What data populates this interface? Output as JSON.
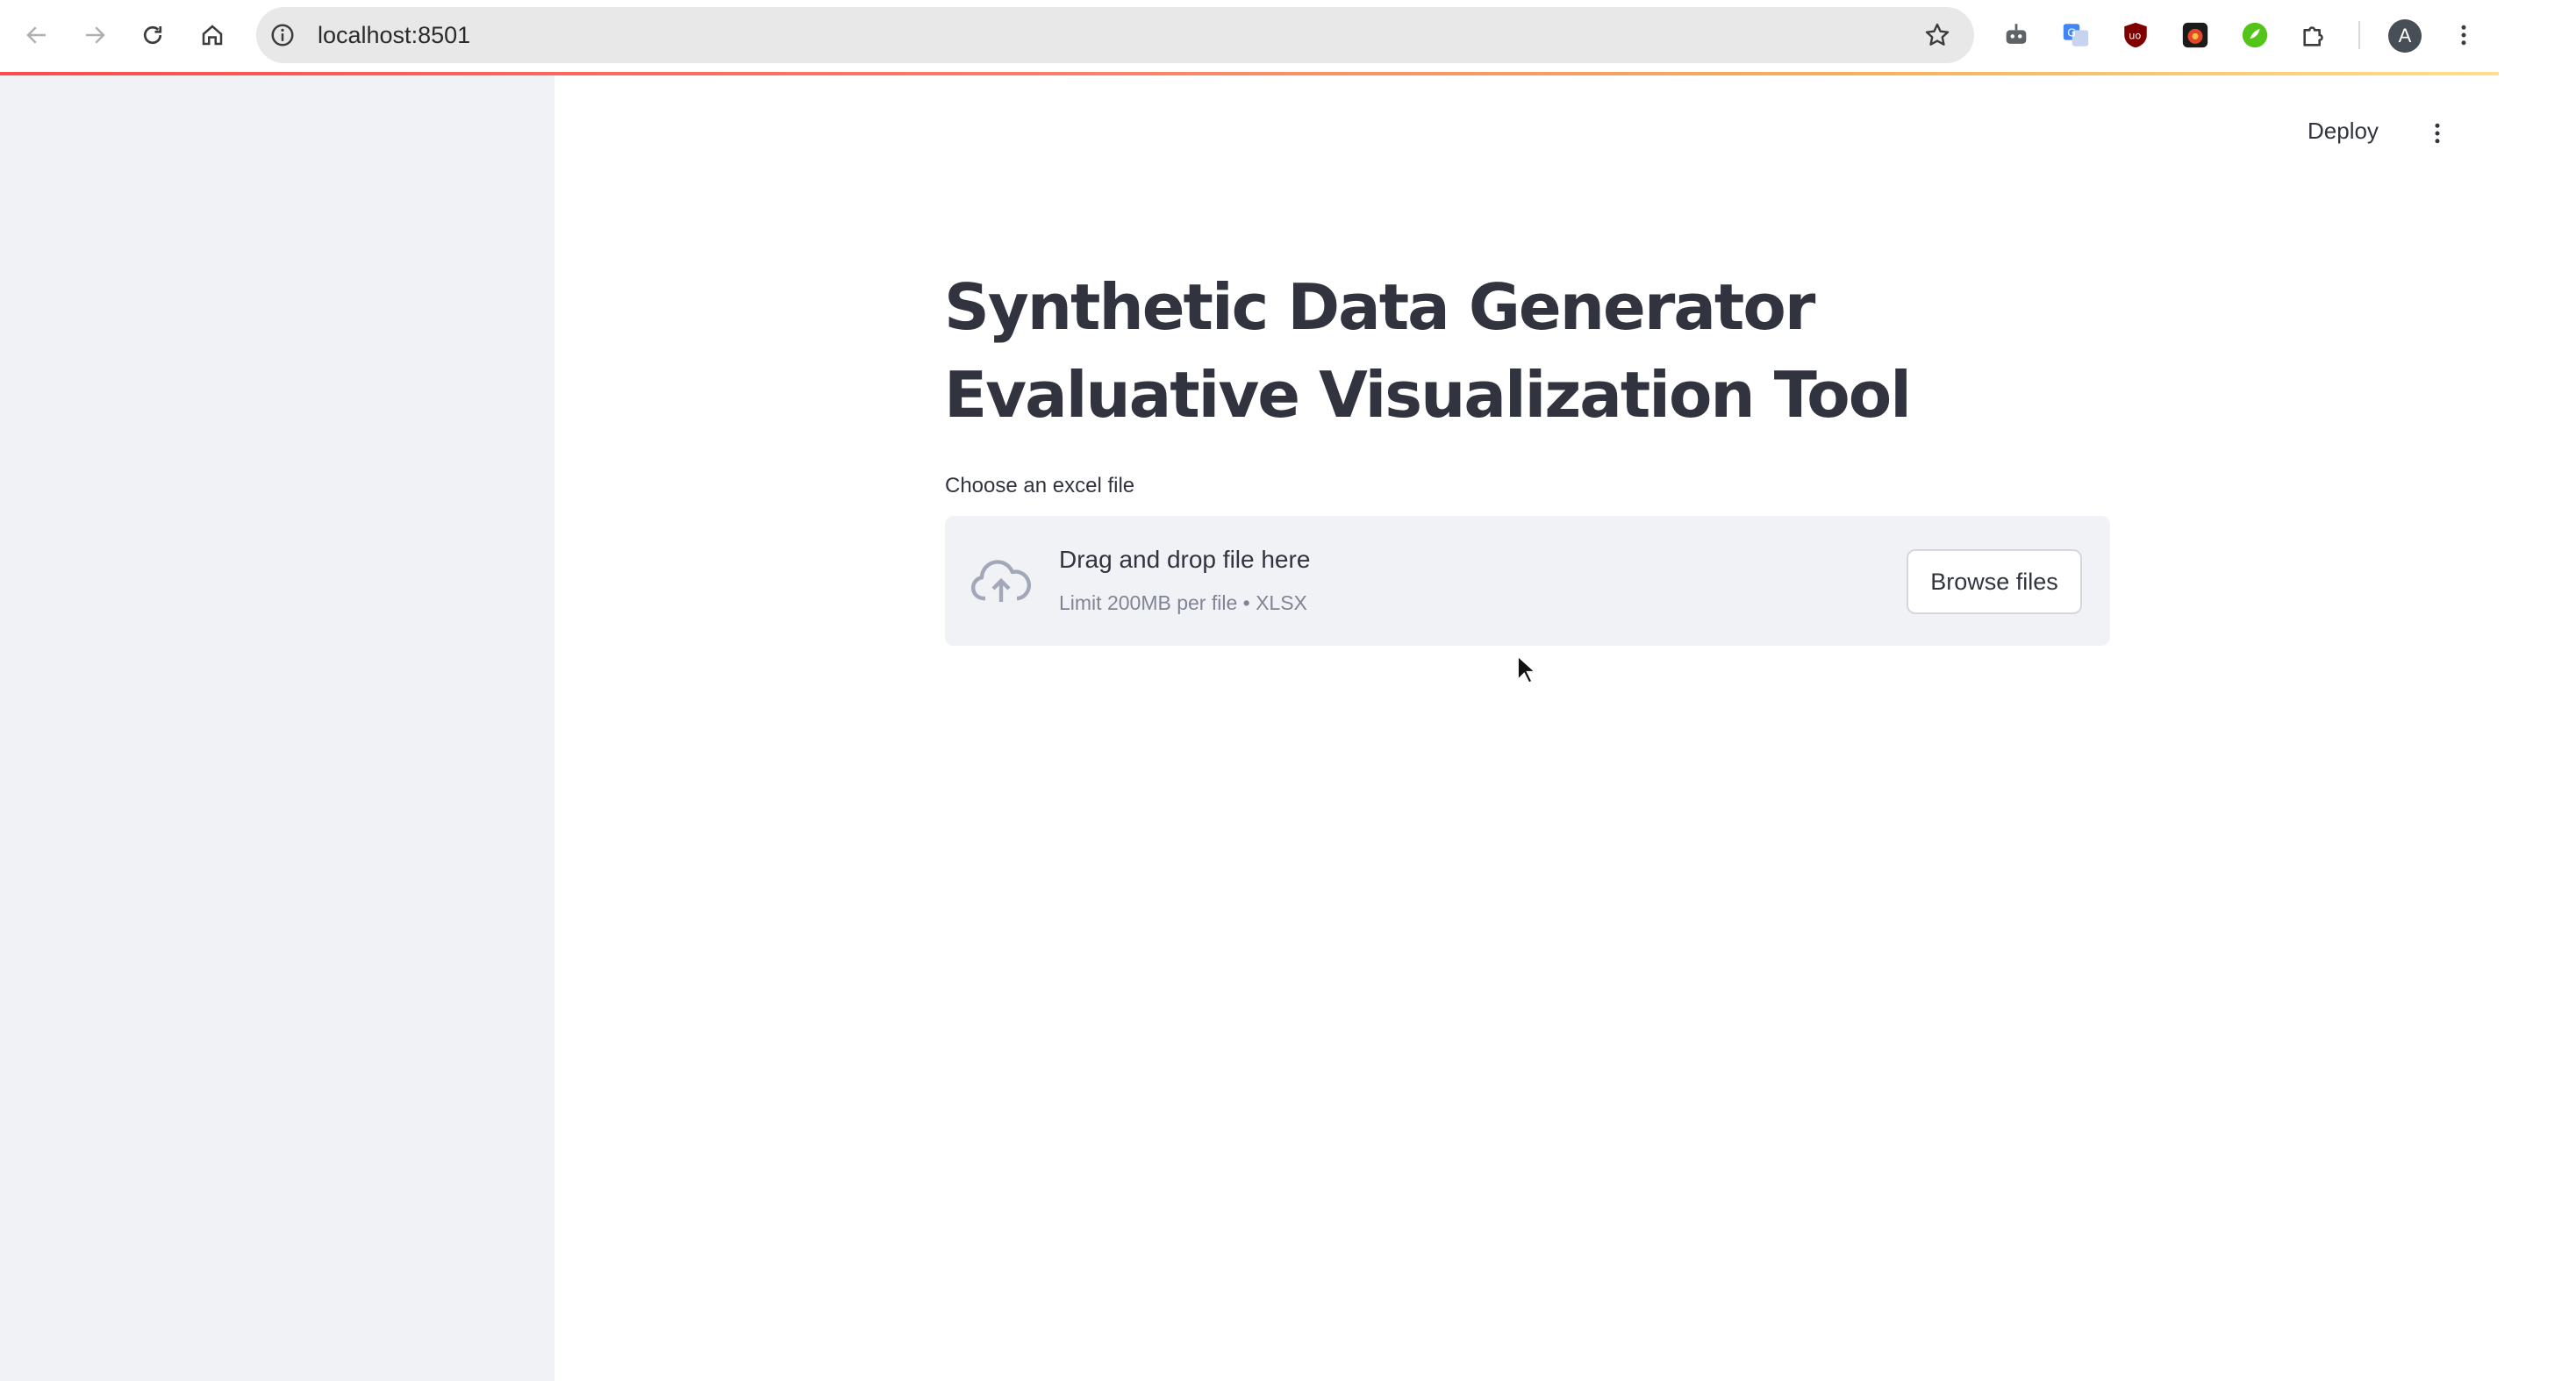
{
  "browser": {
    "url": "localhost:8501",
    "profile_initial": "A",
    "loading_colors": [
      "#ff4b4b",
      "#f5b25c",
      "#ffe08a"
    ],
    "extensions": [
      "robot-extension-icon",
      "translate-extension-icon",
      "ublock-extension-icon",
      "red-panda-extension-icon",
      "green-leaf-extension-icon",
      "puzzle-extensions-icon"
    ]
  },
  "header": {
    "deploy_label": "Deploy"
  },
  "main": {
    "title": "Synthetic Data Generator Evaluative Visualization Tool",
    "uploader": {
      "label": "Choose an excel file",
      "drop_text": "Drag and drop file here",
      "limit_text": "Limit 200MB per file • XLSX",
      "browse_label": "Browse files"
    }
  },
  "colors": {
    "sidebar_bg": "#f0f2f6",
    "text": "#31333f",
    "muted_text": "#808495",
    "accent": "#ff4b4b"
  }
}
